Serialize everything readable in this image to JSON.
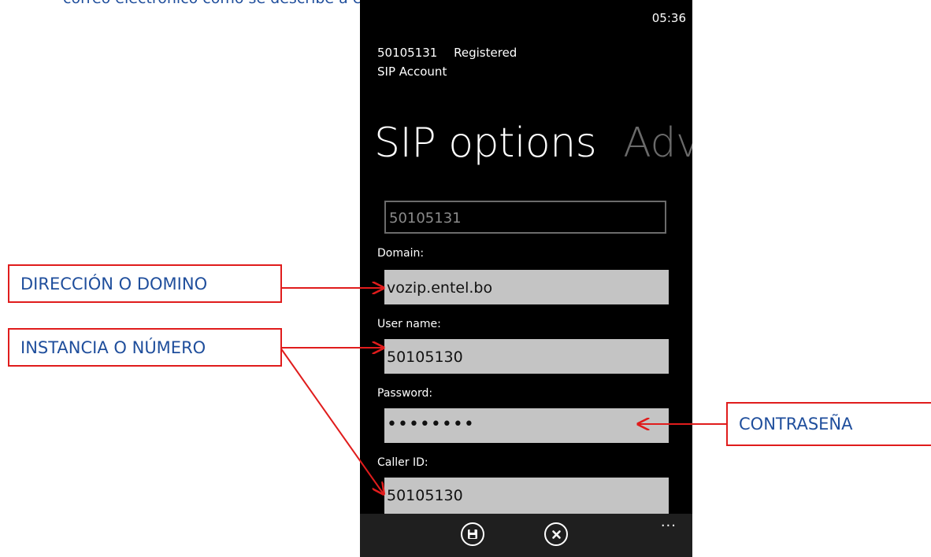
{
  "document": {
    "text": "correo electrónico como se describe a continuación."
  },
  "phone": {
    "clock": "05:36",
    "account_number": "50105131",
    "registration_status": "Registered",
    "account_type": "SIP Account",
    "pivot_title": "SIP options",
    "pivot_next": "Advanced",
    "readonly_field": "50105131",
    "domain_label": "Domain:",
    "domain_value": "vozip.entel.bo",
    "username_label": "User name:",
    "username_value": "50105130",
    "password_label": "Password:",
    "password_value": "••••••••",
    "callerid_label": "Caller ID:",
    "callerid_value": "50105130",
    "appbar_more": "..."
  },
  "callouts": {
    "domain": "DIRECCIÓN O DOMINO",
    "instance": "INSTANCIA O NÚMERO",
    "password": "CONTRASEÑA"
  },
  "colors": {
    "callout_border": "#e01c1c",
    "callout_text": "#1f4e9c",
    "phone_background": "#000000",
    "input_background": "#c4c4c4"
  },
  "icons": [
    "save-icon",
    "close-icon",
    "more-icon"
  ]
}
